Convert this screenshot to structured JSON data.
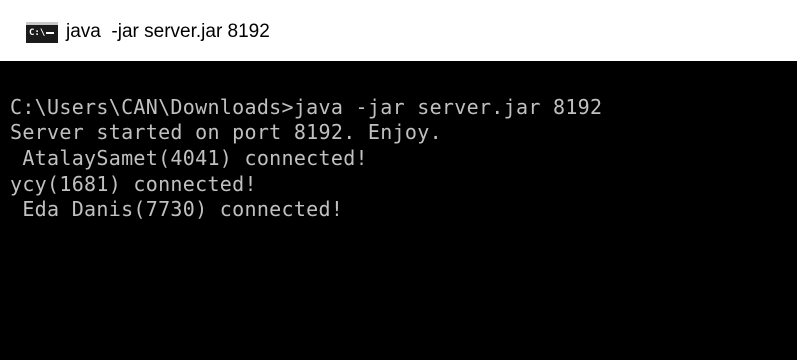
{
  "window": {
    "title": "java  -jar server.jar 8192",
    "icon": "command-prompt-icon",
    "icon_text": "C:\\"
  },
  "console": {
    "lines": [
      "C:\\Users\\CAN\\Downloads>java -jar server.jar 8192",
      "Server started on port 8192. Enjoy.",
      " AtalaySamet(4041) connected!",
      "ycy(1681) connected!",
      " Eda Danis(7730) connected!"
    ]
  },
  "colors": {
    "titlebar_bg": "#ffffff",
    "console_bg": "#000000",
    "console_text": "#c0c0c0"
  }
}
